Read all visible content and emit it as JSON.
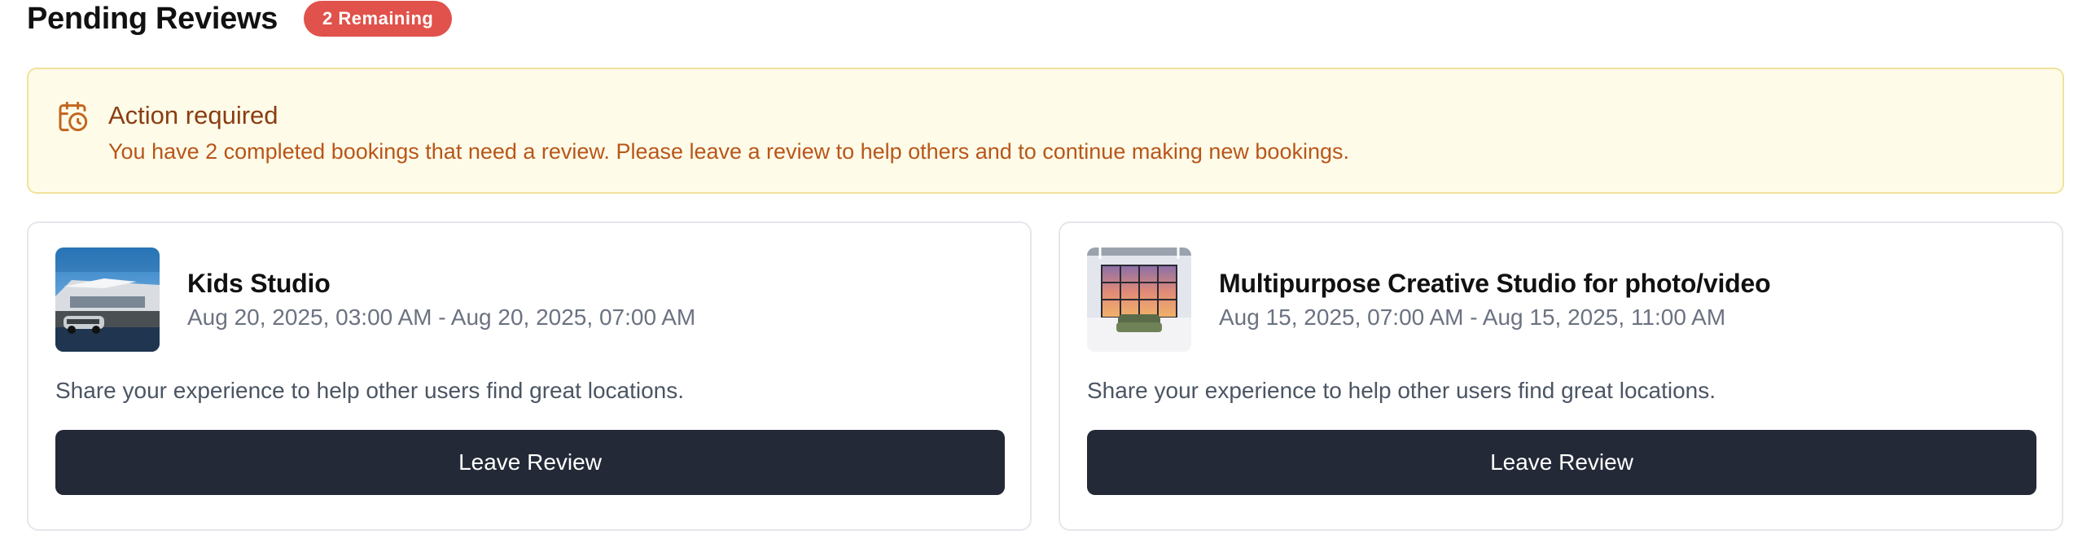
{
  "header": {
    "title": "Pending Reviews",
    "badge": "2 Remaining"
  },
  "alert": {
    "icon": "calendar-clock-icon",
    "title": "Action required",
    "message": "You have 2 completed bookings that need a review. Please leave a review to help others and to continue making new bookings."
  },
  "cards": [
    {
      "title": "Kids Studio",
      "dates": "Aug 20, 2025, 03:00 AM - Aug 20, 2025, 07:00 AM",
      "description": "Share your experience to help other users find great locations.",
      "button_label": "Leave Review",
      "thumbnail": "exterior-building-photo"
    },
    {
      "title": "Multipurpose Creative Studio for photo/video",
      "dates": "Aug 15, 2025, 07:00 AM - Aug 15, 2025, 11:00 AM",
      "description": "Share your experience to help other users find great locations.",
      "button_label": "Leave Review",
      "thumbnail": "studio-interior-photo"
    }
  ],
  "colors": {
    "badge": "#e0524b",
    "alert_bg": "#fefbe8",
    "alert_border": "#f0e29b",
    "alert_title": "#8a3d12",
    "alert_text": "#b8561a",
    "button_bg": "#232936"
  }
}
